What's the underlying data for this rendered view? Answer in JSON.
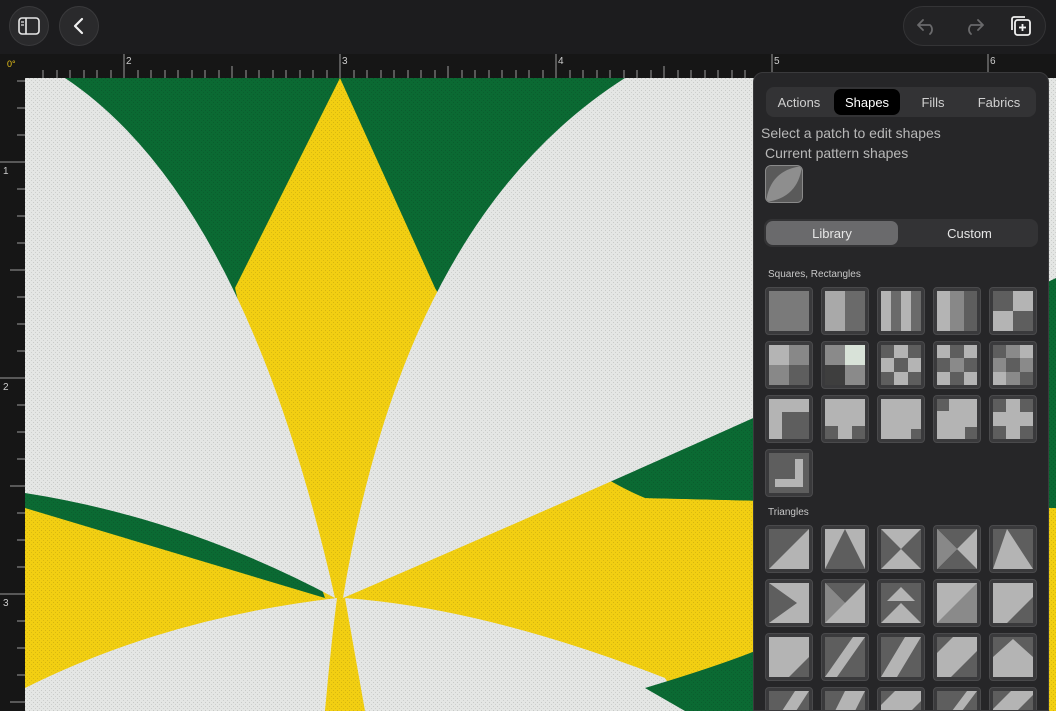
{
  "toolbar": {
    "sidebar_icon": "sidebar-icon",
    "back_icon": "chevron-left-icon",
    "undo_icon": "undo-icon",
    "redo_icon": "redo-icon",
    "duplicate_icon": "add-page-icon"
  },
  "rulers": {
    "angle": "0°",
    "top_labels": [
      "2",
      "3",
      "4",
      "5",
      "6"
    ],
    "left_labels": [
      "1",
      "2",
      "3"
    ]
  },
  "panel": {
    "tabs": [
      "Actions",
      "Shapes",
      "Fills",
      "Fabrics"
    ],
    "active_tab": "Shapes",
    "hint": "Select a patch to edit shapes",
    "current_label": "Current pattern shapes",
    "segments": [
      "Library",
      "Custom"
    ],
    "active_segment": "Library",
    "sections": {
      "squares": "Squares, Rectangles",
      "triangles": "Triangles"
    }
  },
  "colors": {
    "green": "#0b6a33",
    "yellow": "#f2cf12",
    "fabric_white": "#e4e6e4",
    "panel_bg": "#262628"
  }
}
